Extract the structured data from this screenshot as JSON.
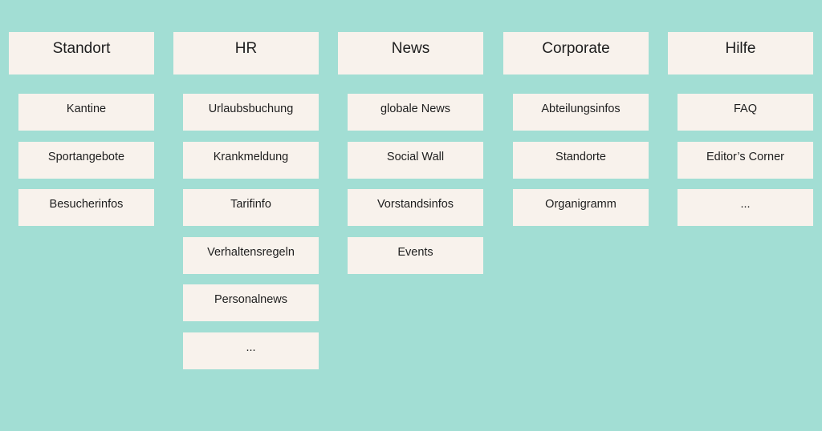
{
  "columns": [
    {
      "title": "Standort",
      "items": [
        "Kantine",
        "Sportangebote",
        "Besucherinfos"
      ]
    },
    {
      "title": "HR",
      "items": [
        "Urlaubsbuchung",
        "Krankmeldung",
        "Tarifinfo",
        "Verhaltensregeln",
        "Personalnews",
        "..."
      ]
    },
    {
      "title": "News",
      "items": [
        "globale News",
        "Social Wall",
        "Vorstandsinfos",
        "Events"
      ]
    },
    {
      "title": "Corporate",
      "items": [
        "Abteilungsinfos",
        "Standorte",
        "Organigramm"
      ]
    },
    {
      "title": "Hilfe",
      "items": [
        "FAQ",
        "Editor’s Corner",
        "..."
      ]
    }
  ],
  "colors": {
    "background": "#a2ded4",
    "box": "#f8f2ec",
    "text": "#1e1e1e"
  }
}
